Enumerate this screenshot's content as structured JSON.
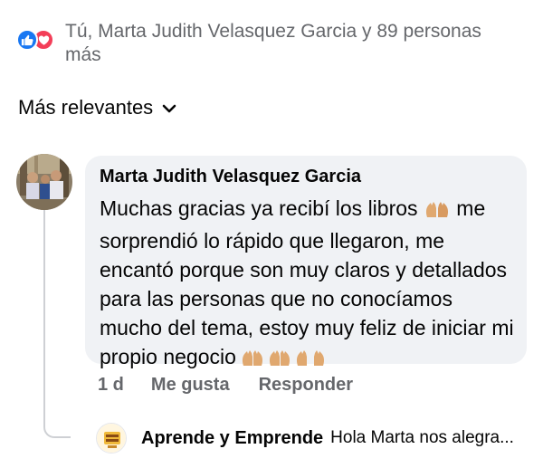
{
  "reactions": {
    "text": "Tú, Marta Judith Velasquez Garcia y 89 personas más",
    "icons": [
      "like-icon",
      "love-icon"
    ],
    "like_color": "#1877f2",
    "love_color": "#f33e58"
  },
  "sort": {
    "label": "Más relevantes",
    "icon": "chevron-down-icon"
  },
  "comment": {
    "author": "Marta Judith Velasquez Garcia",
    "text_parts": [
      "Muchas gracias ya recibí los libros ",
      " me sorprendió lo rápido que llegaron, me encantó porque son muy claros y detallados para las personas que no conocíamos mucho del tema, estoy muy feliz de iniciar mi propio negocio "
    ],
    "time": "1 d",
    "like_label": "Me gusta",
    "reply_label": "Responder"
  },
  "reply": {
    "author": "Aprende y Emprende",
    "preview": "Hola Marta nos alegra..."
  },
  "colors": {
    "bubble_bg": "#f0f2f5",
    "secondary_text": "#65676b",
    "thread_line": "#ced0d4"
  }
}
